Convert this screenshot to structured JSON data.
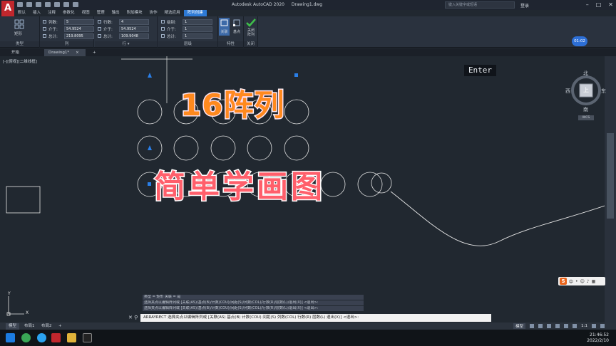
{
  "titlebar": {
    "app": "Autodesk AutoCAD 2020",
    "file": "Drawing1.dwg",
    "search_placeholder": "键入关键字或短语",
    "login": "登录",
    "logo_letter": "A"
  },
  "menu_tabs": [
    "默认",
    "插入",
    "注释",
    "参数化",
    "视图",
    "管理",
    "输出",
    "附加模块",
    "协作",
    "精选应用",
    "阵列创建"
  ],
  "ribbon": {
    "type_panel": {
      "button": "矩形",
      "label": "类型"
    },
    "columns_panel": {
      "label": "列",
      "rows": [
        {
          "name": "列数:",
          "value": "5"
        },
        {
          "name": "介于:",
          "value": "54.9524"
        },
        {
          "name": "总计:",
          "value": "219.8095"
        }
      ]
    },
    "rows_panel": {
      "label": "行 ▾",
      "rows": [
        {
          "name": "行数:",
          "value": "4"
        },
        {
          "name": "介于:",
          "value": "54.9524"
        },
        {
          "name": "总计:",
          "value": "109.9048"
        }
      ]
    },
    "levels_panel": {
      "label": "层级",
      "rows": [
        {
          "name": "级别:",
          "value": "1"
        },
        {
          "name": "介于:",
          "value": "1"
        },
        {
          "name": "总计:",
          "value": "1"
        }
      ]
    },
    "props_panel": {
      "label": "特性",
      "buttons": [
        "关联",
        "基点"
      ]
    },
    "close_panel": {
      "label": "关闭",
      "button_line1": "关闭",
      "button_line2": "阵列"
    }
  },
  "timer": "01:02",
  "file_tabs": [
    "开始",
    "Drawing1*"
  ],
  "view_label": "[-][俯视][二维线框]",
  "enter_key": "Enter",
  "overlay": {
    "line1": "16阵列",
    "line2": "简单学画图"
  },
  "compass": {
    "north": "北",
    "south": "南",
    "east": "东",
    "west": "西",
    "top": "上",
    "wcs": "WCS"
  },
  "ucs": {
    "x": "X",
    "y": "Y"
  },
  "command": {
    "history": [
      "类型 = 矩形  关联 = 是",
      "选择夹点以编辑阵列或 [关联(AS)/基点(B)/计数(COU)/间距(S)/列数(COL)/行数(R)/层数(L)/退出(X)] <退出>:",
      "选择夹点以编辑阵列或 [关联(AS)/基点(B)/计数(COU)/间距(S)/列数(COL)/行数(R)/层数(L)/退出(X)] <退出>:"
    ],
    "prompt": "ARRAYRECT 选择夹点以编辑阵列或 [关联(AS) 基点(B) 计数(COU) 间距(S) 列数(COL) 行数(R) 层数(L) 退出(X)] <退出>:"
  },
  "layout_tabs": [
    "模型",
    "布局1",
    "布局2"
  ],
  "status": {
    "model": "模型",
    "scale": "1:1"
  },
  "ime": {
    "lang": "中"
  },
  "clock": {
    "time": "21:46:52",
    "date": "2022/2/10"
  }
}
